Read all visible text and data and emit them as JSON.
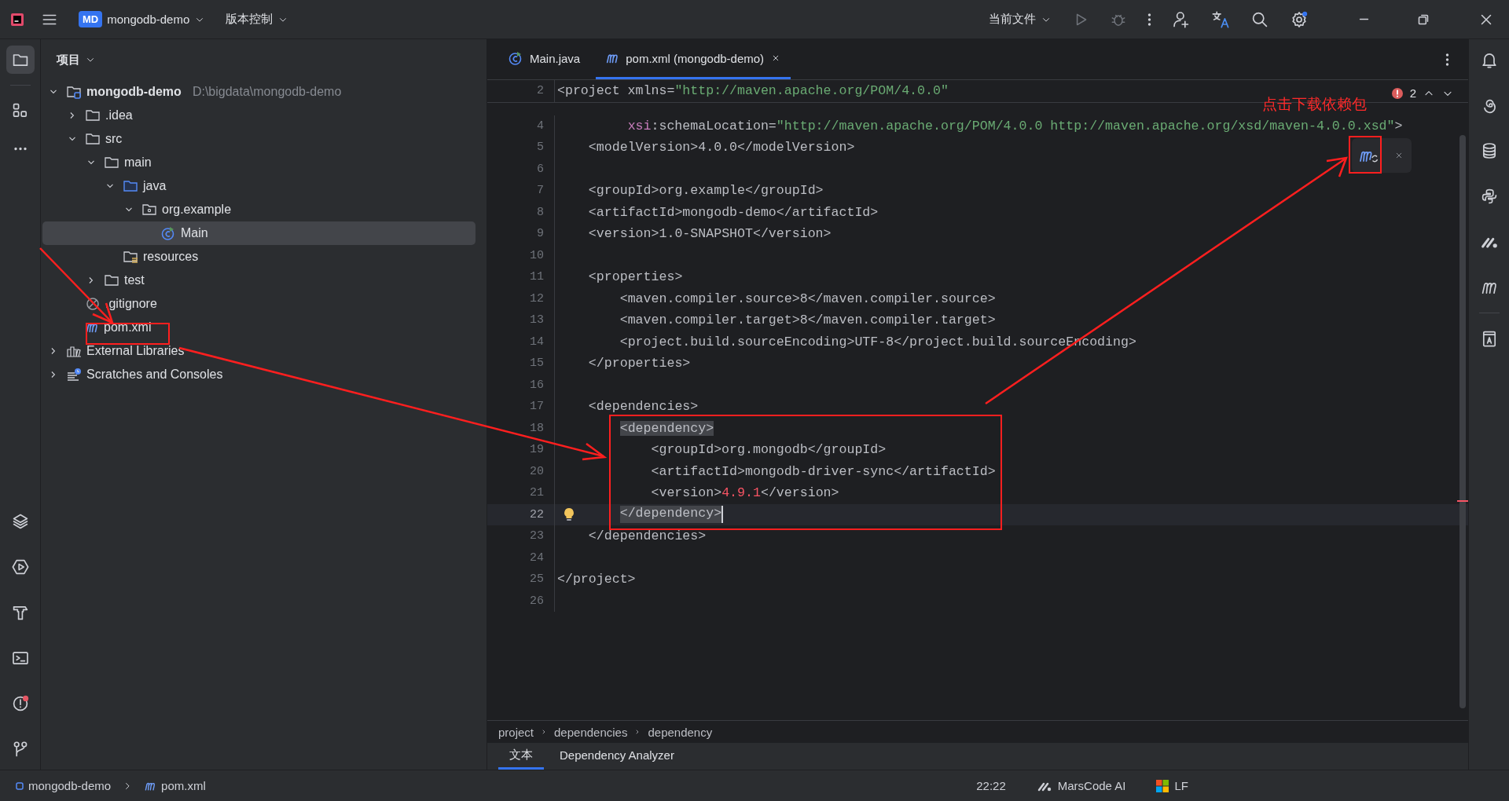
{
  "title_bar": {
    "project_badge": "MD",
    "project": "mongodb-demo",
    "vcs": "版本控制",
    "run_config": "当前文件"
  },
  "project_panel": {
    "title": "项目",
    "tree": [
      {
        "label": "mongodb-demo",
        "path": "D:\\bigdata\\mongodb-demo",
        "kind": "module",
        "expanded": true,
        "selected": false,
        "children": [
          {
            "label": ".idea",
            "kind": "folder",
            "expanded": false,
            "selected": false
          },
          {
            "label": "src",
            "kind": "folder",
            "expanded": true,
            "selected": false,
            "children": [
              {
                "label": "main",
                "kind": "folder",
                "expanded": true,
                "selected": false,
                "children": [
                  {
                    "label": "java",
                    "kind": "source-folder",
                    "expanded": true,
                    "selected": false,
                    "children": [
                      {
                        "label": "org.example",
                        "kind": "package",
                        "expanded": true,
                        "selected": false,
                        "children": [
                          {
                            "label": "Main",
                            "kind": "class",
                            "selected": true
                          }
                        ]
                      }
                    ]
                  },
                  {
                    "label": "resources",
                    "kind": "resources",
                    "selected": false
                  }
                ]
              },
              {
                "label": "test",
                "kind": "folder",
                "expanded": false,
                "selected": false
              }
            ]
          },
          {
            "label": ".gitignore",
            "kind": "ignore-file",
            "selected": false
          },
          {
            "label": "pom.xml",
            "kind": "maven",
            "selected": false
          }
        ]
      },
      {
        "label": "External Libraries",
        "kind": "libraries",
        "expanded": false,
        "selected": false
      },
      {
        "label": "Scratches and Consoles",
        "kind": "scratches",
        "expanded": false,
        "selected": false
      }
    ]
  },
  "editor_tabs": [
    {
      "label": "Main.java",
      "kind": "class",
      "selected": false
    },
    {
      "label": "pom.xml (mongodb-demo)",
      "kind": "maven",
      "selected": true
    }
  ],
  "inspection": {
    "count": "2"
  },
  "sticky_line": {
    "number": "2",
    "parts": [
      {
        "kind": "plain",
        "text": "<project xmlns="
      },
      {
        "kind": "value",
        "text": "\"http://maven.apache.org/POM/4.0.0\""
      }
    ]
  },
  "code_lines": [
    {
      "number": "4",
      "current": false,
      "intention": false,
      "parts": [
        {
          "kind": "ns",
          "text": "         xsi"
        },
        {
          "kind": "plain",
          "text": ":schemaLocation="
        },
        {
          "kind": "value",
          "text": "\"http://maven.apache.org/POM/4.0.0 http://maven.apache.org/xsd/maven-4.0.0.xsd\""
        },
        {
          "kind": "plain",
          "text": ">"
        }
      ]
    },
    {
      "number": "5",
      "current": false,
      "intention": false,
      "parts": [
        {
          "kind": "plain",
          "text": "    <modelVersion>4.0.0</modelVersion>"
        }
      ]
    },
    {
      "number": "6",
      "current": false,
      "intention": false
    },
    {
      "number": "7",
      "current": false,
      "intention": false,
      "parts": [
        {
          "kind": "plain",
          "text": "    <groupId>org.example</groupId>"
        }
      ]
    },
    {
      "number": "8",
      "current": false,
      "intention": false,
      "parts": [
        {
          "kind": "plain",
          "text": "    <artifactId>mongodb-demo</artifactId>"
        }
      ]
    },
    {
      "number": "9",
      "current": false,
      "intention": false,
      "parts": [
        {
          "kind": "plain",
          "text": "    <version>1.0-SNAPSHOT</version>"
        }
      ]
    },
    {
      "number": "10",
      "current": false,
      "intention": false
    },
    {
      "number": "11",
      "current": false,
      "intention": false,
      "parts": [
        {
          "kind": "plain",
          "text": "    <properties>"
        }
      ]
    },
    {
      "number": "12",
      "current": false,
      "intention": false,
      "parts": [
        {
          "kind": "plain",
          "text": "        <maven.compiler.source>8</maven.compiler.source>"
        }
      ]
    },
    {
      "number": "13",
      "current": false,
      "intention": false,
      "parts": [
        {
          "kind": "plain",
          "text": "        <maven.compiler.target>8</maven.compiler.target>"
        }
      ]
    },
    {
      "number": "14",
      "current": false,
      "intention": false,
      "parts": [
        {
          "kind": "plain",
          "text": "        <project.build.sourceEncoding>UTF-8</project.build.sourceEncoding>"
        }
      ]
    },
    {
      "number": "15",
      "current": false,
      "intention": false,
      "parts": [
        {
          "kind": "plain",
          "text": "    </properties>"
        }
      ]
    },
    {
      "number": "16",
      "current": false,
      "intention": false
    },
    {
      "number": "17",
      "current": false,
      "intention": false,
      "parts": [
        {
          "kind": "plain",
          "text": "    <dependencies>"
        }
      ]
    },
    {
      "number": "18",
      "current": false,
      "intention": false,
      "parts": [
        {
          "kind": "match",
          "text": "        <dependency>"
        }
      ]
    },
    {
      "number": "19",
      "current": false,
      "intention": false,
      "parts": [
        {
          "kind": "plain",
          "text": "            <groupId>org.mongodb</groupId>"
        }
      ]
    },
    {
      "number": "20",
      "current": false,
      "intention": false,
      "parts": [
        {
          "kind": "plain",
          "text": "            <artifactId>mongodb-driver-sync</artifactId>"
        }
      ]
    },
    {
      "number": "21",
      "current": false,
      "intention": false,
      "parts": [
        {
          "kind": "plain",
          "text": "            <version>"
        },
        {
          "kind": "error",
          "text": "4.9.1"
        },
        {
          "kind": "plain",
          "text": "</version>"
        }
      ]
    },
    {
      "number": "22",
      "current": true,
      "intention": true,
      "parts": [
        {
          "kind": "match",
          "text": "        </dependency>"
        }
      ]
    },
    {
      "number": "23",
      "current": false,
      "intention": false,
      "parts": [
        {
          "kind": "plain",
          "text": "    </dependencies>"
        }
      ]
    },
    {
      "number": "24",
      "current": false,
      "intention": false
    },
    {
      "number": "25",
      "current": false,
      "intention": false,
      "parts": [
        {
          "kind": "plain",
          "text": "</project>"
        }
      ]
    },
    {
      "number": "26",
      "current": false,
      "intention": false
    }
  ],
  "breadcrumbs": [
    "project",
    "dependencies",
    "dependency"
  ],
  "bottom_tabs": [
    {
      "label": "文本",
      "selected": true
    },
    {
      "label": "Dependency Analyzer",
      "selected": false
    }
  ],
  "status_bar": {
    "path": [
      {
        "label": "mongodb-demo",
        "kind": "module"
      },
      {
        "label": "pom.xml",
        "kind": "maven"
      }
    ],
    "items": [
      {
        "label": "22:22",
        "kind": "text"
      },
      {
        "label": "MarsCode AI",
        "kind": "marscode"
      },
      {
        "label": "LF",
        "kind": "windows"
      }
    ]
  },
  "annotation": {
    "label": "点击下载依赖包"
  }
}
